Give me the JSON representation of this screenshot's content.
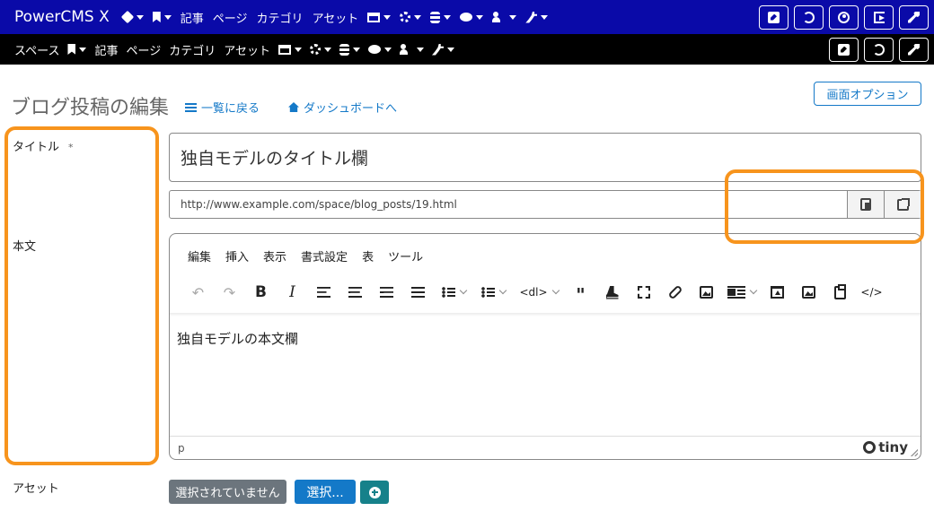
{
  "app": {
    "brand": "PowerCMS X"
  },
  "nav_top": {
    "items": [
      {
        "icon": "cube-icon",
        "label": "",
        "caret": true
      },
      {
        "icon": "bookmark-icon",
        "label": "",
        "caret": true
      },
      {
        "icon": "",
        "label": "記事",
        "caret": false
      },
      {
        "icon": "",
        "label": "ページ",
        "caret": false
      },
      {
        "icon": "",
        "label": "カテゴリ",
        "caret": false
      },
      {
        "icon": "",
        "label": "アセット",
        "caret": false
      },
      {
        "icon": "window-icon",
        "label": "",
        "caret": true
      },
      {
        "icon": "gear-icon",
        "label": "",
        "caret": true
      },
      {
        "icon": "database-icon",
        "label": "",
        "caret": true
      },
      {
        "icon": "comments-icon",
        "label": "",
        "caret": true
      },
      {
        "icon": "user-plus-icon",
        "label": "",
        "caret": true
      },
      {
        "icon": "plug-icon",
        "label": "",
        "caret": true
      }
    ],
    "buttons": [
      "edit-square-icon",
      "sync-icon",
      "user-circle-icon",
      "sign-out-icon",
      "wrench-icon"
    ]
  },
  "nav_space": {
    "label": "スペース",
    "items": [
      {
        "icon": "bookmark-icon",
        "label": "",
        "caret": true
      },
      {
        "icon": "",
        "label": "記事",
        "caret": false
      },
      {
        "icon": "",
        "label": "ページ",
        "caret": false
      },
      {
        "icon": "",
        "label": "カテゴリ",
        "caret": false
      },
      {
        "icon": "",
        "label": "アセット",
        "caret": false
      },
      {
        "icon": "window-icon",
        "label": "",
        "caret": true
      },
      {
        "icon": "gear-icon",
        "label": "",
        "caret": true
      },
      {
        "icon": "database-icon",
        "label": "",
        "caret": true
      },
      {
        "icon": "comments-icon",
        "label": "",
        "caret": true
      },
      {
        "icon": "user-plus-icon",
        "label": "",
        "caret": true
      },
      {
        "icon": "plug-icon",
        "label": "",
        "caret": true
      }
    ],
    "buttons": [
      "edit-square-icon",
      "sync-icon",
      "wrench-icon"
    ]
  },
  "page": {
    "title": "ブログ投稿の編集",
    "back_to_list": "一覧に戻る",
    "dashboard": "ダッシュボードへ",
    "screen_options": "画面オプション"
  },
  "fields": {
    "title_label": "タイトル",
    "required_mark": "*",
    "title_value": "独自モデルのタイトル欄",
    "url": "http://www.example.com/space/blog_posts/19.html",
    "body_label": "本文",
    "asset_label": "アセット"
  },
  "editor": {
    "menu": [
      "編集",
      "挿入",
      "表示",
      "書式設定",
      "表",
      "ツール"
    ],
    "dl_label": "<dl>",
    "code_label": "</>",
    "body_text": "独自モデルの本文欄",
    "status_path": "p",
    "brand": "tiny"
  },
  "asset": {
    "none_selected": "選択されていません",
    "select": "選択..."
  },
  "colors": {
    "nav_top_bg": "#0a0aa8",
    "nav_space_bg": "#000000",
    "link": "#1479c8",
    "highlight": "#f7941d",
    "btn_gray": "#6c757d",
    "btn_teal": "#16818a"
  }
}
